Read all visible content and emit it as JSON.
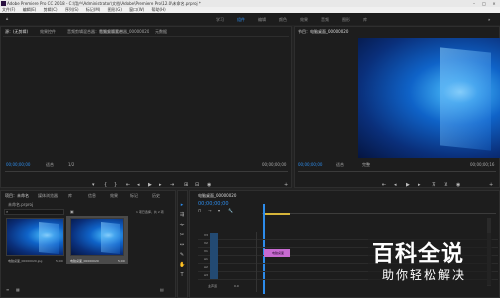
{
  "titlebar": {
    "title": "Adobe Premiere Pro CC 2018 - C:\\用户\\Administrator\\文档\\Adobe\\Premiere Pro\\12.0\\未命名.prproj *",
    "min": "–",
    "max": "□",
    "close": "×"
  },
  "menu": [
    "文件(F)",
    "编辑(E)",
    "剪辑(C)",
    "序列(S)",
    "标记(M)",
    "图形(G)",
    "窗口(W)",
    "帮助(H)"
  ],
  "workspaces": [
    "学习",
    "组件",
    "编辑",
    "颜色",
    "效果",
    "音频",
    "图形",
    "库"
  ],
  "source_panel": {
    "tabs": [
      "源：(无剪辑)",
      "效果控件",
      "音频剪辑混合器：电脑桌面素材",
      "音频剪辑混合器_00000020",
      "元数据"
    ],
    "timecode_left": "00;00;00;00",
    "fit": "适合",
    "page": "1/2",
    "timecode_right": "00;00;00;00"
  },
  "program_panel": {
    "title": "节目：电脑桌面_00000020",
    "timecode_left": "00;00;00;00",
    "fit": "适合",
    "page": "完整",
    "timecode_right": "00;00;00;16"
  },
  "project_panel": {
    "tabs": [
      "项目：未命名",
      "媒体浏览器",
      "库",
      "信息",
      "效果",
      "标记",
      "历史"
    ],
    "name": "未命名.prproj",
    "count": "1 项已选择，共 2 项",
    "items": [
      {
        "label": "电脑桌面_00000020.jpg",
        "duration": "5;00"
      },
      {
        "label": "电脑桌面_00000020",
        "duration": "5;00"
      }
    ]
  },
  "timeline": {
    "tab": "电脑桌面_00000020",
    "timecode": "00;00;00;00",
    "tracks": [
      "V3",
      "V2",
      "V1",
      "A1",
      "A2",
      "A3"
    ],
    "master": "主声道",
    "master_value": "0.0",
    "clip_label": "电脑桌面"
  },
  "watermark": {
    "title": "百科全说",
    "subtitle": "助你轻松解决"
  }
}
